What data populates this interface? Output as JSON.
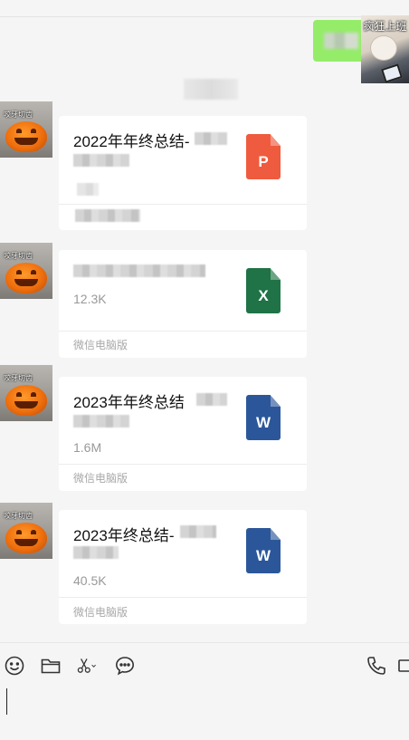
{
  "own_message": {
    "avatar_caption": "疯狂上班"
  },
  "messages": [
    {
      "avatar_caption": "咬牙切齿",
      "file_name": "2022年年终总结-",
      "file_size": "",
      "source": "",
      "file_type": "ppt",
      "icon_letter": "P",
      "icon_color": "#ef5b3e"
    },
    {
      "avatar_caption": "咬牙切齿",
      "file_name": "",
      "file_size": "12.3K",
      "source": "微信电脑版",
      "file_type": "excel",
      "icon_letter": "X",
      "icon_color": "#1f7346"
    },
    {
      "avatar_caption": "咬牙切齿",
      "file_name": "2023年年终总结",
      "file_size": "1.6M",
      "source": "微信电脑版",
      "file_type": "word",
      "icon_letter": "W",
      "icon_color": "#2b579a"
    },
    {
      "avatar_caption": "咬牙切齿",
      "file_name": "2023年终总结-",
      "file_size": "40.5K",
      "source": "微信电脑版",
      "file_type": "word",
      "icon_letter": "W",
      "icon_color": "#2b579a"
    }
  ],
  "toolbar": {
    "icons": [
      "emoji-icon",
      "folder-icon",
      "scissors-icon",
      "chat-history-icon",
      "phone-icon",
      "video-icon"
    ]
  }
}
